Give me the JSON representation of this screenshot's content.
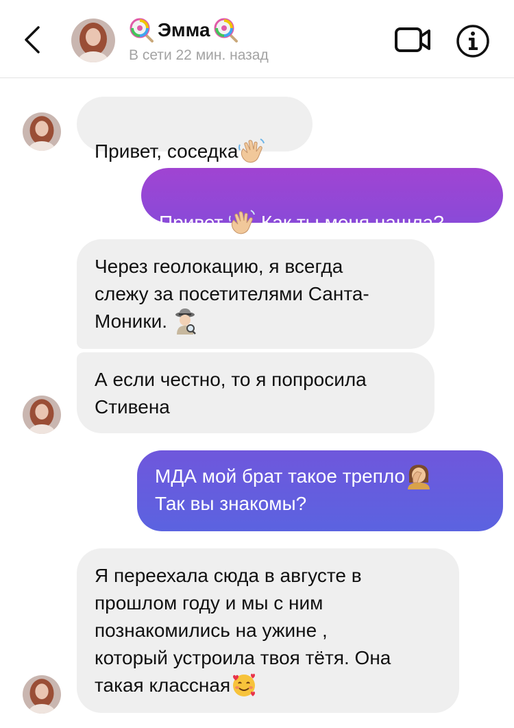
{
  "header": {
    "name": "Эмма",
    "status": "В сети 22 мин. назад"
  },
  "messages": [
    {
      "text": "Привет, соседка",
      "emoji": "waving-hand"
    },
    {
      "text_before": "Привет ",
      "emoji": "waving-hand",
      "text_after": " Как ты меня нашла?"
    },
    {
      "lines": [
        "Через геолокацию, я всегда",
        "слежу за посетителями Санта-",
        "Моники. "
      ],
      "emoji": "detective"
    },
    {
      "lines": [
        "А если честно, то я попросила",
        "Стивена"
      ]
    },
    {
      "lines": [
        "МДА мой брат такое трепло",
        "Так вы знакомы?"
      ],
      "emoji": "facepalm-woman"
    },
    {
      "lines": [
        "Я переехала сюда в августе в",
        "прошлом году и мы с ним",
        "познакомились на ужине ,",
        "который устроила твоя тётя. Она",
        "такая классная"
      ],
      "emoji": "smiling-face-with-hearts"
    }
  ],
  "colors": {
    "incoming_bubble": "#efefef",
    "outgoing_gradient_top": "#9b45d4",
    "outgoing_gradient_bottom": "#5b63e0",
    "status_text": "#a3a3a3"
  }
}
